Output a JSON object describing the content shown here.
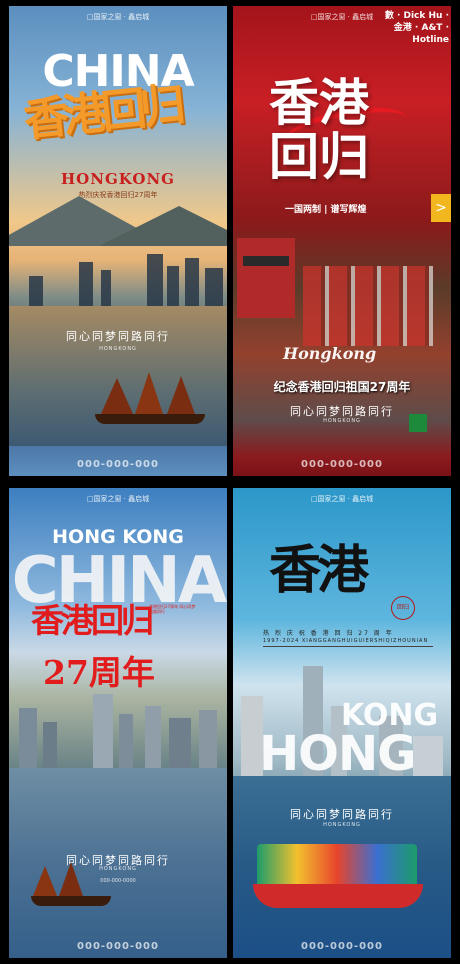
{
  "poster1": {
    "brand": "□国家之窗 · 鑫启城",
    "china": "CHINA",
    "calligraphy": "香港回归",
    "hongkong": "HONGKONG",
    "subtitle": "热烈庆祝香港回归27周年",
    "slogan": "同心同梦同路同行",
    "hk_small": "HONGKONG",
    "phone": "000-000-000"
  },
  "poster2": {
    "brand": "□国家之窗 · 鑫启城",
    "signs": "數 · Dick Hu · 金港 · A&T · Hotline",
    "title_line1": "香港",
    "title_line2": "回归",
    "tagline": "一国两制 | 谱写辉煌",
    "arrow": ">",
    "script": "Hongkong",
    "memorial": "纪念香港回归祖国27周年",
    "slogan": "同心同梦同路同行",
    "hk_small": "HONGKONG",
    "phone": "000-000-000"
  },
  "poster3": {
    "brand": "□国家之窗 · 鑫启城",
    "hong_kong": "HONG KONG",
    "china": "CHINA",
    "calligraphy": "香港回归",
    "years": "27周年",
    "memo_small": "香港回归27周年 同心同梦 同路同行",
    "slogan": "同心同梦同路同行",
    "hk_small": "HONGKONG",
    "phone_mid": "000-000-0000",
    "phone": "000-000-000"
  },
  "poster4": {
    "brand": "□国家之窗 · 鑫启城",
    "calligraphy": "香港",
    "seal": "回归",
    "sub1": "热 烈 庆 祝 香 港 回 归 27 周 年",
    "sub2": "1997-2024  XIANGGANGHUIGUIERSHIQIZHOUNIAN",
    "kong": "KONG",
    "hong": "HONG",
    "slogan": "同心同梦同路同行",
    "hk_small": "HONGKONG",
    "phone": "000-000-000"
  },
  "colors": {
    "orange_calligraphy": "#f39a2b",
    "red_accent": "#e21c1c",
    "poster2_red": "#c91f25",
    "sky_blue": "#2c97c9"
  }
}
